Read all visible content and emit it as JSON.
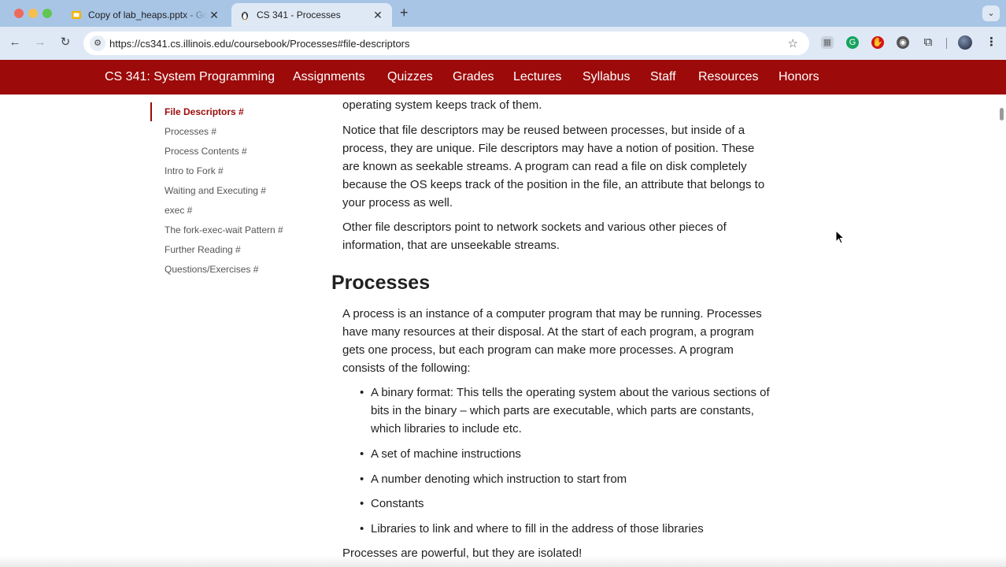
{
  "browser": {
    "tabs": [
      {
        "title": "Copy of lab_heaps.pptx - Google Slides",
        "active": false,
        "favicon": "slides-icon",
        "favicon_color": "#f4b400"
      },
      {
        "title": "CS 341 - Processes",
        "active": true,
        "favicon": "tux-icon"
      }
    ],
    "new_tab_symbol": "+",
    "url": "https://cs341.cs.illinois.edu/coursebook/Processes#file-descriptors"
  },
  "site": {
    "brand": "CS 341: System Programming",
    "nav": [
      "Assignments",
      "Quizzes",
      "Grades",
      "Lectures",
      "Syllabus",
      "Staff",
      "Resources",
      "Honors"
    ],
    "colors": {
      "header_bg": "#9c0a0a",
      "header_text": "#ffffff",
      "active_toc": "#9c0a0a"
    }
  },
  "toc": {
    "items": [
      {
        "label": "File Descriptors #",
        "active": true
      },
      {
        "label": "Processes #"
      },
      {
        "label": "Process Contents #"
      },
      {
        "label": "Intro to Fork #"
      },
      {
        "label": "Waiting and Executing #"
      },
      {
        "label": "exec #"
      },
      {
        "label": "The fork-exec-wait Pattern #"
      },
      {
        "label": "Further Reading #"
      },
      {
        "label": "Questions/Exercises #"
      }
    ]
  },
  "content": {
    "fd_tail": "operating system keeps track of them.",
    "fd_para2_lines": [
      "Notice that file descriptors may be reused between processes, but inside of a",
      "process, they are unique. File descriptors may have a notion of position. These",
      "are known as seekable streams. A program can read a file on disk completely",
      "because the OS keeps track of the position in the file, an attribute that belongs to",
      "your process as well."
    ],
    "fd_para3_lines": [
      "Other file descriptors point to network sockets and various other pieces of",
      "information, that are unseekable streams."
    ],
    "processes_heading": "Processes",
    "processes_intro_lines": [
      "A process is an instance of a computer program that may be running. Processes",
      "have many resources at their disposal. At the start of each program, a program",
      "gets one process, but each program can make more processes. A program",
      "consists of the following:"
    ],
    "bullets": [
      {
        "lines": [
          "A binary format: This tells the operating system about the various sections of",
          "bits in the binary – which parts are executable, which parts are constants,",
          "which libraries to include etc."
        ]
      },
      {
        "lines": [
          "A set of machine instructions"
        ]
      },
      {
        "lines": [
          "A number denoting which instruction to start from"
        ]
      },
      {
        "lines": [
          "Constants"
        ]
      },
      {
        "lines": [
          "Libraries to link and where to fill in the address of those libraries"
        ]
      }
    ],
    "closing": "Processes are powerful, but they are isolated!"
  }
}
